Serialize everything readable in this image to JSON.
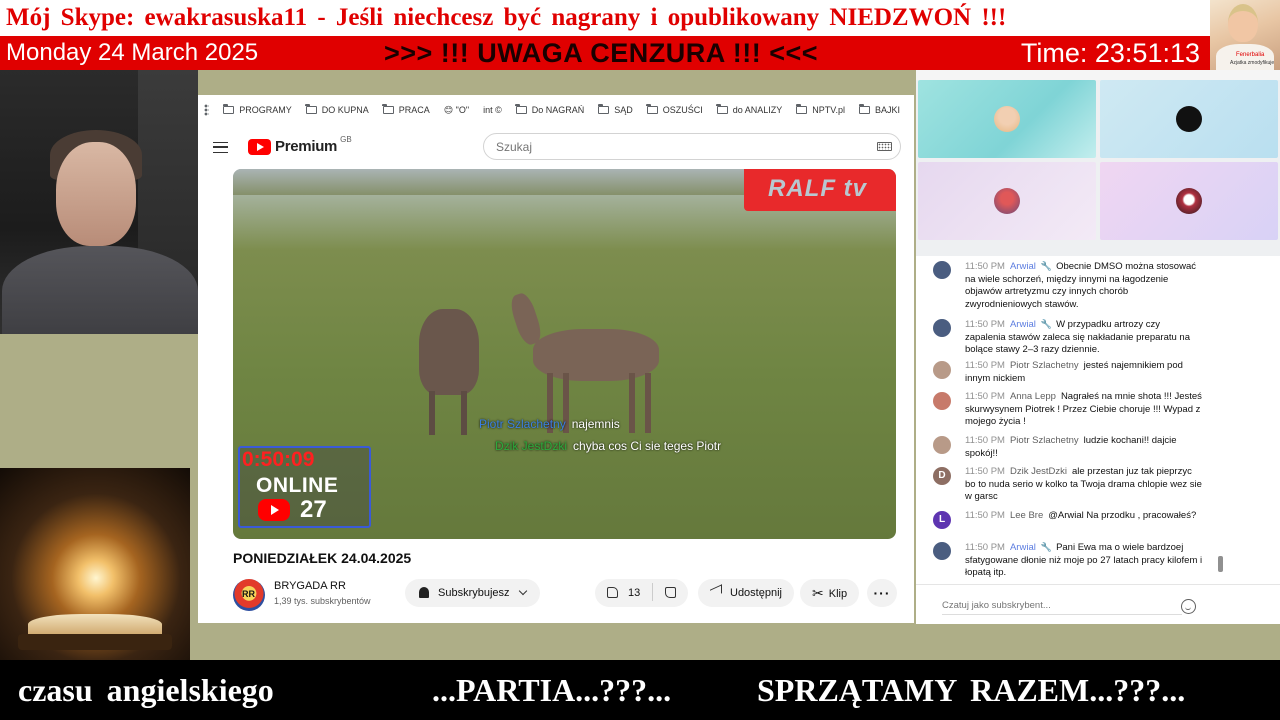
{
  "overlay": {
    "banner": "Mój Skype: ewakrasuska11 - Jeśli niechcesz być nagrany i opublikowany NIEDZWOŃ !!!",
    "date": "Monday 24 March 2025",
    "warning": ">>> !!! UWAGA CENZURA !!! <<<",
    "time": "Time: 23:51:13",
    "host_thumb_line1": "Fenerbalia",
    "host_thumb_line2": "Azjatka zmodyfikuje"
  },
  "bookmarks": [
    {
      "label": "PROGRAMY",
      "icon": "folder-icon"
    },
    {
      "label": "DO KUPNA",
      "icon": "folder-icon"
    },
    {
      "label": "PRACA",
      "icon": "folder-icon"
    },
    {
      "label": "😊 \"O\"",
      "icon": ""
    },
    {
      "label": "int ©",
      "icon": ""
    },
    {
      "label": "Do NAGRAŃ",
      "icon": "folder-icon"
    },
    {
      "label": "SĄD",
      "icon": "folder-icon"
    },
    {
      "label": "OSZUŚCI",
      "icon": "folder-icon"
    },
    {
      "label": "do ANALIZY",
      "icon": "folder-icon"
    },
    {
      "label": "NPTV.pl",
      "icon": "folder-icon"
    },
    {
      "label": "BAJKI",
      "icon": "folder-icon"
    }
  ],
  "youtube": {
    "logo": "Premium",
    "region": "GB",
    "search_placeholder": "Szukaj",
    "video_title": "PONIEDZIAŁEK 24.04.2025",
    "channel_name": "BRYGADA RR",
    "channel_subs": "1,39 tys. subskrybentów",
    "avatar_text": "RR",
    "subscribe_label": "Subskrybujesz",
    "like_count": "13",
    "share_label": "Udostępnij",
    "clip_label": "Klip",
    "more_label": "···"
  },
  "video": {
    "watermark": "RALF tv",
    "timer": "0:50:09",
    "online_label": "ONLINE",
    "online_count": "27",
    "chat1_nick": "Piotr Szlachetny",
    "chat1_text": "najemnis",
    "chat2_nick": "Dzik JestDzki",
    "chat2_text": "chyba cos Ci sie teges Piotr"
  },
  "chat": {
    "messages": [
      {
        "time": "11:50 PM",
        "author": "Arwial",
        "mod": true,
        "avatar": "",
        "avatar_color": "#4a5d80",
        "text": "Obecnie DMSO można stosować na wiele schorzeń, między innymi na łagodzenie objawów artretyzmu czy innych chorób zwyrodnieniowych stawów."
      },
      {
        "time": "11:50 PM",
        "author": "Arwial",
        "mod": true,
        "avatar": "",
        "avatar_color": "#4a5d80",
        "text": "W przypadku artrozy czy zapalenia stawów zaleca się nakładanie preparatu na bolące stawy 2–3 razy dziennie."
      },
      {
        "time": "11:50 PM",
        "author": "Piotr Szlachetny",
        "mod": false,
        "avatar": "",
        "avatar_color": "#b89a88",
        "text": "jesteś najemnikiem pod innym nickiem"
      },
      {
        "time": "11:50 PM",
        "author": "Anna Lepp",
        "mod": false,
        "avatar": "",
        "avatar_color": "#c77a6a",
        "text": "Nagrałeś na mnie shota !!! Jesteś skurwysynem Piotrek ! Przez Ciebie choruje !!! Wypad z mojego życia !"
      },
      {
        "time": "11:50 PM",
        "author": "Piotr Szlachetny",
        "mod": false,
        "avatar": "",
        "avatar_color": "#b89a88",
        "text": "ludzie kochani!! dajcie spokój!!"
      },
      {
        "time": "11:50 PM",
        "author": "Dzik JestDzki",
        "mod": false,
        "avatar": "D",
        "avatar_color": "#8d6e63",
        "text": "ale przestan juz tak pieprzyc bo to nuda serio w kolko ta Twoja drama chlopie wez sie w garsc"
      },
      {
        "time": "11:50 PM",
        "author": "Lee Bre",
        "mod": false,
        "avatar": "L",
        "avatar_color": "#5e35b1",
        "text": "@Arwial Na przodku , pracowałeś?"
      },
      {
        "time": "11:50 PM",
        "author": "Arwial",
        "mod": true,
        "avatar": "",
        "avatar_color": "#4a5d80",
        "text": "Pani Ewa ma o wiele bardzoej sfatygowane dłonie niż moje po 27 latach pracy kilofem i łopatą itp."
      }
    ],
    "input_placeholder": "Czatuj jako subskrybent..."
  },
  "ticker": {
    "part1": "czasu angielskiego",
    "part2": "...PARTIA...???...",
    "part3": "SPRZĄTAMY RAZEM...???..."
  }
}
